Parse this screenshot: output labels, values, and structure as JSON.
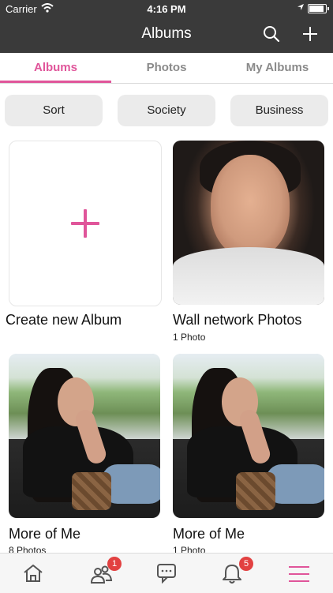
{
  "status_bar": {
    "carrier": "Carrier",
    "time": "4:16 PM"
  },
  "nav": {
    "title": "Albums",
    "search_icon": "search-icon",
    "add_icon": "plus-icon"
  },
  "tabs": [
    {
      "label": "Albums",
      "active": true
    },
    {
      "label": "Photos",
      "active": false
    },
    {
      "label": "My Albums",
      "active": false
    }
  ],
  "filters": [
    "Sort",
    "Society",
    "Business"
  ],
  "albums": [
    {
      "title": "Create new Album",
      "subtitle": ""
    },
    {
      "title": "Wall network Photos",
      "subtitle": "1 Photo"
    },
    {
      "title": "More of Me",
      "subtitle": "8 Photos"
    },
    {
      "title": "More of Me",
      "subtitle": "1 Photo"
    }
  ],
  "bottom_nav": {
    "items": [
      "home-icon",
      "friends-icon",
      "messages-icon",
      "notifications-icon",
      "menu-icon"
    ],
    "friends_badge": "1",
    "notifications_badge": "5"
  },
  "colors": {
    "accent": "#e0559a",
    "header_bg": "#3a3a3a",
    "badge": "#e24141"
  }
}
